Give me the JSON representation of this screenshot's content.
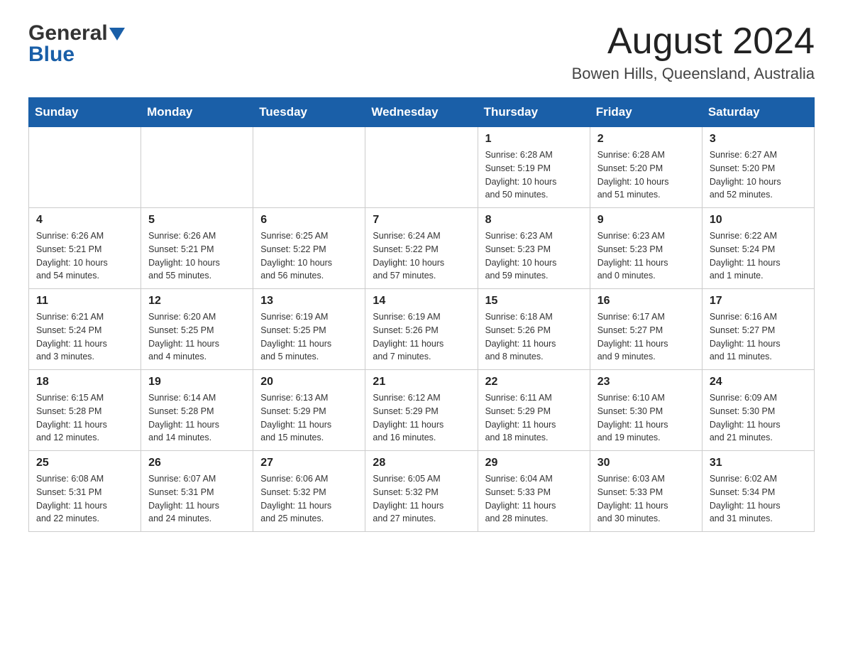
{
  "header": {
    "logo_general": "General",
    "logo_blue": "Blue",
    "month_title": "August 2024",
    "location": "Bowen Hills, Queensland, Australia"
  },
  "weekdays": [
    "Sunday",
    "Monday",
    "Tuesday",
    "Wednesday",
    "Thursday",
    "Friday",
    "Saturday"
  ],
  "weeks": [
    {
      "days": [
        {
          "number": "",
          "info": ""
        },
        {
          "number": "",
          "info": ""
        },
        {
          "number": "",
          "info": ""
        },
        {
          "number": "",
          "info": ""
        },
        {
          "number": "1",
          "info": "Sunrise: 6:28 AM\nSunset: 5:19 PM\nDaylight: 10 hours\nand 50 minutes."
        },
        {
          "number": "2",
          "info": "Sunrise: 6:28 AM\nSunset: 5:20 PM\nDaylight: 10 hours\nand 51 minutes."
        },
        {
          "number": "3",
          "info": "Sunrise: 6:27 AM\nSunset: 5:20 PM\nDaylight: 10 hours\nand 52 minutes."
        }
      ]
    },
    {
      "days": [
        {
          "number": "4",
          "info": "Sunrise: 6:26 AM\nSunset: 5:21 PM\nDaylight: 10 hours\nand 54 minutes."
        },
        {
          "number": "5",
          "info": "Sunrise: 6:26 AM\nSunset: 5:21 PM\nDaylight: 10 hours\nand 55 minutes."
        },
        {
          "number": "6",
          "info": "Sunrise: 6:25 AM\nSunset: 5:22 PM\nDaylight: 10 hours\nand 56 minutes."
        },
        {
          "number": "7",
          "info": "Sunrise: 6:24 AM\nSunset: 5:22 PM\nDaylight: 10 hours\nand 57 minutes."
        },
        {
          "number": "8",
          "info": "Sunrise: 6:23 AM\nSunset: 5:23 PM\nDaylight: 10 hours\nand 59 minutes."
        },
        {
          "number": "9",
          "info": "Sunrise: 6:23 AM\nSunset: 5:23 PM\nDaylight: 11 hours\nand 0 minutes."
        },
        {
          "number": "10",
          "info": "Sunrise: 6:22 AM\nSunset: 5:24 PM\nDaylight: 11 hours\nand 1 minute."
        }
      ]
    },
    {
      "days": [
        {
          "number": "11",
          "info": "Sunrise: 6:21 AM\nSunset: 5:24 PM\nDaylight: 11 hours\nand 3 minutes."
        },
        {
          "number": "12",
          "info": "Sunrise: 6:20 AM\nSunset: 5:25 PM\nDaylight: 11 hours\nand 4 minutes."
        },
        {
          "number": "13",
          "info": "Sunrise: 6:19 AM\nSunset: 5:25 PM\nDaylight: 11 hours\nand 5 minutes."
        },
        {
          "number": "14",
          "info": "Sunrise: 6:19 AM\nSunset: 5:26 PM\nDaylight: 11 hours\nand 7 minutes."
        },
        {
          "number": "15",
          "info": "Sunrise: 6:18 AM\nSunset: 5:26 PM\nDaylight: 11 hours\nand 8 minutes."
        },
        {
          "number": "16",
          "info": "Sunrise: 6:17 AM\nSunset: 5:27 PM\nDaylight: 11 hours\nand 9 minutes."
        },
        {
          "number": "17",
          "info": "Sunrise: 6:16 AM\nSunset: 5:27 PM\nDaylight: 11 hours\nand 11 minutes."
        }
      ]
    },
    {
      "days": [
        {
          "number": "18",
          "info": "Sunrise: 6:15 AM\nSunset: 5:28 PM\nDaylight: 11 hours\nand 12 minutes."
        },
        {
          "number": "19",
          "info": "Sunrise: 6:14 AM\nSunset: 5:28 PM\nDaylight: 11 hours\nand 14 minutes."
        },
        {
          "number": "20",
          "info": "Sunrise: 6:13 AM\nSunset: 5:29 PM\nDaylight: 11 hours\nand 15 minutes."
        },
        {
          "number": "21",
          "info": "Sunrise: 6:12 AM\nSunset: 5:29 PM\nDaylight: 11 hours\nand 16 minutes."
        },
        {
          "number": "22",
          "info": "Sunrise: 6:11 AM\nSunset: 5:29 PM\nDaylight: 11 hours\nand 18 minutes."
        },
        {
          "number": "23",
          "info": "Sunrise: 6:10 AM\nSunset: 5:30 PM\nDaylight: 11 hours\nand 19 minutes."
        },
        {
          "number": "24",
          "info": "Sunrise: 6:09 AM\nSunset: 5:30 PM\nDaylight: 11 hours\nand 21 minutes."
        }
      ]
    },
    {
      "days": [
        {
          "number": "25",
          "info": "Sunrise: 6:08 AM\nSunset: 5:31 PM\nDaylight: 11 hours\nand 22 minutes."
        },
        {
          "number": "26",
          "info": "Sunrise: 6:07 AM\nSunset: 5:31 PM\nDaylight: 11 hours\nand 24 minutes."
        },
        {
          "number": "27",
          "info": "Sunrise: 6:06 AM\nSunset: 5:32 PM\nDaylight: 11 hours\nand 25 minutes."
        },
        {
          "number": "28",
          "info": "Sunrise: 6:05 AM\nSunset: 5:32 PM\nDaylight: 11 hours\nand 27 minutes."
        },
        {
          "number": "29",
          "info": "Sunrise: 6:04 AM\nSunset: 5:33 PM\nDaylight: 11 hours\nand 28 minutes."
        },
        {
          "number": "30",
          "info": "Sunrise: 6:03 AM\nSunset: 5:33 PM\nDaylight: 11 hours\nand 30 minutes."
        },
        {
          "number": "31",
          "info": "Sunrise: 6:02 AM\nSunset: 5:34 PM\nDaylight: 11 hours\nand 31 minutes."
        }
      ]
    }
  ]
}
